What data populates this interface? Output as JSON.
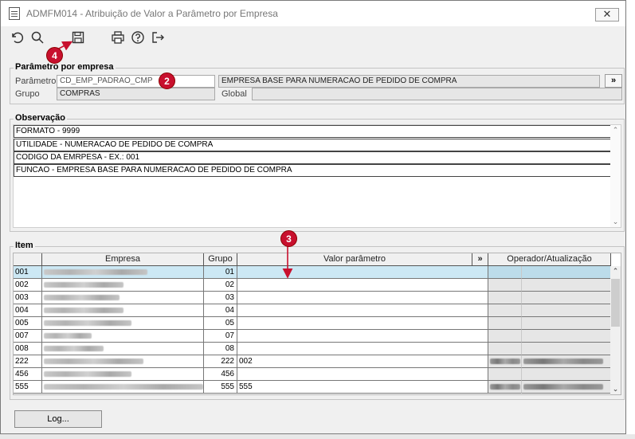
{
  "window": {
    "title": "ADMFM014 - Atribuição de Valor a Parâmetro por Empresa",
    "close_glyph": "✕"
  },
  "toolbar": {
    "icons": [
      "undo-icon",
      "search-icon",
      "save-icon",
      "print-icon",
      "help-icon",
      "exit-icon"
    ]
  },
  "callouts": {
    "c2": "2",
    "c3": "3",
    "c4": "4"
  },
  "parametro_section": {
    "title": "Parâmetro por empresa",
    "parametro_label": "Parâmetro",
    "parametro_value": "CD_EMP_PADRAO_CMP",
    "parametro_desc": "EMPRESA BASE PARA NUMERACAO DE PEDIDO DE COMPRA",
    "lookup_label": "»",
    "grupo_label": "Grupo",
    "grupo_value": "COMPRAS",
    "global_label": "Global",
    "global_value": ""
  },
  "observacao_section": {
    "title": "Observação",
    "lines": [
      "FORMATO - 9999",
      "UTILIDADE -  NUMERACAO DE PEDIDO DE COMPRA",
      "CODIGO DA EMRPESA - EX.: 001",
      "FUNCAO - EMPRESA BASE PARA NUMERACAO DE PEDIDO DE COMPRA"
    ]
  },
  "item_section": {
    "title": "Item",
    "columns": {
      "empresa": "Empresa",
      "grupo": "Grupo",
      "valor": "Valor parâmetro",
      "expand": "»",
      "operador": "Operador/Atualização"
    },
    "rows": [
      {
        "code": "001",
        "grupo": "01",
        "valor": ""
      },
      {
        "code": "002",
        "grupo": "02",
        "valor": ""
      },
      {
        "code": "003",
        "grupo": "03",
        "valor": ""
      },
      {
        "code": "004",
        "grupo": "04",
        "valor": ""
      },
      {
        "code": "005",
        "grupo": "05",
        "valor": ""
      },
      {
        "code": "007",
        "grupo": "07",
        "valor": ""
      },
      {
        "code": "008",
        "grupo": "08",
        "valor": ""
      },
      {
        "code": "222",
        "grupo": "222",
        "valor": "002"
      },
      {
        "code": "456",
        "grupo": "456",
        "valor": ""
      },
      {
        "code": "555",
        "grupo": "555",
        "valor": "555"
      }
    ]
  },
  "footer": {
    "log_label": "Log..."
  }
}
